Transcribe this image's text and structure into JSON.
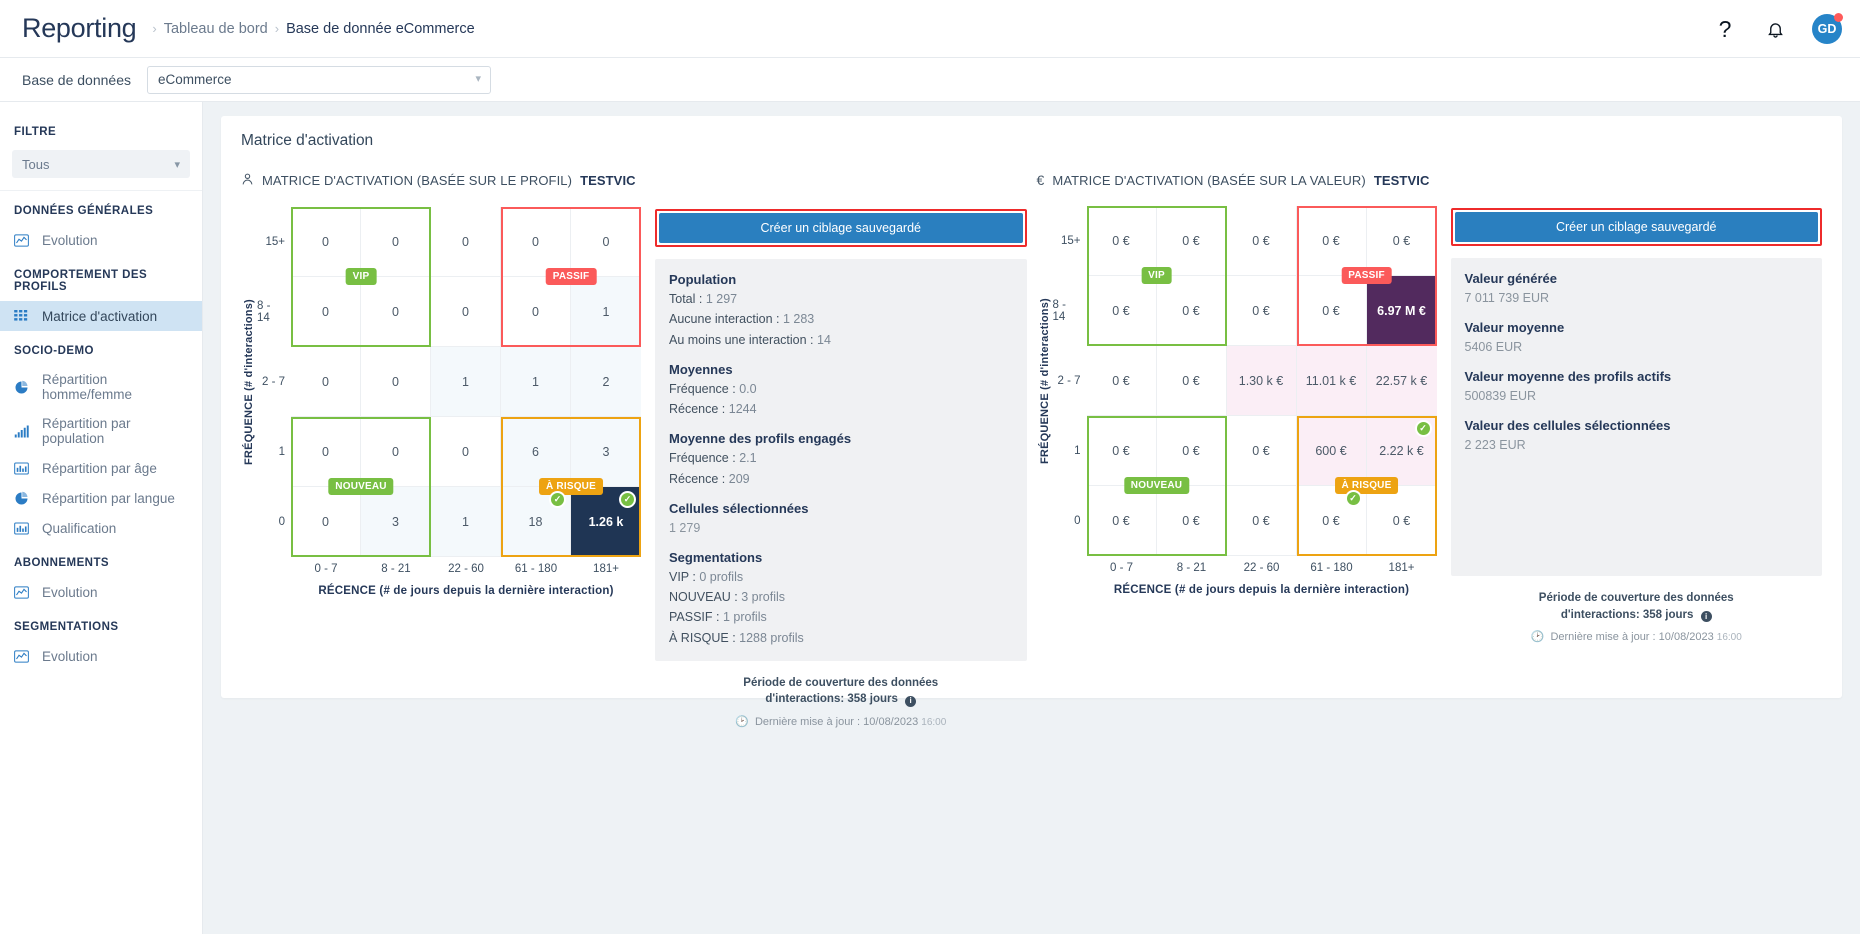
{
  "header": {
    "app_title": "Reporting",
    "breadcrumb": [
      "Tableau de bord",
      "Base de donnée eCommerce"
    ],
    "help_icon": "question-mark-icon",
    "bell_icon": "bell-icon",
    "avatar_initials": "GD"
  },
  "dbbar": {
    "label": "Base de données",
    "value": "eCommerce"
  },
  "sidebar": {
    "filter_heading": "FILTRE",
    "filter_value": "Tous",
    "sections": [
      {
        "heading": "DONNÉES GÉNÉRALES",
        "items": [
          {
            "label": "Evolution",
            "icon": "line-chart-icon",
            "active": false
          }
        ]
      },
      {
        "heading": "COMPORTEMENT DES PROFILS",
        "items": [
          {
            "label": "Matrice d'activation",
            "icon": "grid-icon",
            "active": true
          }
        ]
      },
      {
        "heading": "SOCIO-DEMO",
        "items": [
          {
            "label": "Répartition homme/femme",
            "icon": "pie-chart-icon",
            "active": false
          },
          {
            "label": "Répartition par population",
            "icon": "bar-chart-icon",
            "active": false
          },
          {
            "label": "Répartition par âge",
            "icon": "histogram-icon",
            "active": false
          },
          {
            "label": "Répartition par langue",
            "icon": "pie-chart-icon",
            "active": false
          },
          {
            "label": "Qualification",
            "icon": "histogram-icon",
            "active": false
          }
        ]
      },
      {
        "heading": "ABONNEMENTS",
        "items": [
          {
            "label": "Evolution",
            "icon": "line-chart-icon",
            "active": false
          }
        ]
      },
      {
        "heading": "SEGMENTATIONS",
        "items": [
          {
            "label": "Evolution",
            "icon": "line-chart-icon",
            "active": false
          }
        ]
      }
    ]
  },
  "main": {
    "card_title": "Matrice d'activation"
  },
  "chart_data": [
    {
      "type": "heatmap",
      "id": "profil",
      "title": "MATRICE D'ACTIVATION (BASÉE SUR LE PROFIL)",
      "title_suffix": "TESTVIC",
      "icon": "person-icon",
      "xlabel": "RÉCENCE (# de jours depuis la dernière interaction)",
      "ylabel": "FRÉQUENCE (# d'interactions)",
      "x_categories": [
        "0 - 7",
        "8 - 21",
        "22 - 60",
        "61 - 180",
        "181+"
      ],
      "y_categories": [
        "15+",
        "8 - 14",
        "2 - 7",
        "1",
        "0"
      ],
      "values": [
        [
          "0",
          "0",
          "0",
          "0",
          "0"
        ],
        [
          "0",
          "0",
          "0",
          "0",
          "1"
        ],
        [
          "0",
          "0",
          "1",
          "1",
          "2"
        ],
        [
          "0",
          "0",
          "0",
          "6",
          "3"
        ],
        [
          "0",
          "3",
          "1",
          "18",
          "1.26 k"
        ]
      ],
      "tints": [
        [
          "",
          "",
          "",
          "",
          ""
        ],
        [
          "",
          "",
          "",
          "",
          "tintblue"
        ],
        [
          "",
          "",
          "tintblue",
          "tintblue",
          "tintblue"
        ],
        [
          "",
          "",
          "",
          "tintblue",
          "tintblue"
        ],
        [
          "",
          "tintblue",
          "tintblue",
          "tintblue",
          "dark"
        ]
      ],
      "segments": [
        {
          "name": "VIP",
          "color": "green",
          "col": 0,
          "row": 0,
          "cols": 2,
          "rows": 2
        },
        {
          "name": "PASSIF",
          "color": "red",
          "col": 3,
          "row": 0,
          "cols": 2,
          "rows": 2
        },
        {
          "name": "NOUVEAU",
          "color": "green",
          "col": 0,
          "row": 3,
          "cols": 2,
          "rows": 2
        },
        {
          "name": "À RISQUE",
          "color": "orange",
          "col": 3,
          "row": 3,
          "cols": 2,
          "rows": 2
        }
      ],
      "checks": [
        {
          "col": 3,
          "row": 4
        },
        {
          "col": 4,
          "row": 4
        }
      ]
    },
    {
      "type": "heatmap",
      "id": "valeur",
      "title": "MATRICE D'ACTIVATION (BASÉE SUR LA VALEUR)",
      "title_suffix": "TESTVIC",
      "icon": "euro-icon",
      "xlabel": "RÉCENCE (# de jours depuis la dernière interaction)",
      "ylabel": "FRÉQUENCE (# d'interactions)",
      "x_categories": [
        "0 - 7",
        "8 - 21",
        "22 - 60",
        "61 - 180",
        "181+"
      ],
      "y_categories": [
        "15+",
        "8 - 14",
        "2 - 7",
        "1",
        "0"
      ],
      "values": [
        [
          "0 €",
          "0 €",
          "0 €",
          "0 €",
          "0 €"
        ],
        [
          "0 €",
          "0 €",
          "0 €",
          "0 €",
          "6.97 M €"
        ],
        [
          "0 €",
          "0 €",
          "1.30 k €",
          "11.01 k €",
          "22.57 k €"
        ],
        [
          "0 €",
          "0 €",
          "0 €",
          "600 €",
          "2.22 k €"
        ],
        [
          "0 €",
          "0 €",
          "0 €",
          "0 €",
          "0 €"
        ]
      ],
      "tints": [
        [
          "",
          "",
          "",
          "",
          ""
        ],
        [
          "",
          "",
          "",
          "",
          "purple"
        ],
        [
          "",
          "",
          "tintpink",
          "tintpink",
          "tintpink"
        ],
        [
          "",
          "",
          "",
          "tintpink",
          "tintpink"
        ],
        [
          "",
          "",
          "",
          "",
          ""
        ]
      ],
      "segments": [
        {
          "name": "VIP",
          "color": "green",
          "col": 0,
          "row": 0,
          "cols": 2,
          "rows": 2
        },
        {
          "name": "PASSIF",
          "color": "red",
          "col": 3,
          "row": 0,
          "cols": 2,
          "rows": 2
        },
        {
          "name": "NOUVEAU",
          "color": "green",
          "col": 0,
          "row": 3,
          "cols": 2,
          "rows": 2
        },
        {
          "name": "À RISQUE",
          "color": "orange",
          "col": 3,
          "row": 3,
          "cols": 2,
          "rows": 2
        }
      ],
      "checks": [
        {
          "col": 4,
          "row": 3
        },
        {
          "col": 3,
          "row": 4
        }
      ]
    }
  ],
  "left_panel": {
    "cta_label": "Créer un ciblage sauvegardé",
    "groups": [
      {
        "title": "Population",
        "lines": [
          {
            "k": "Total :",
            "v": "1 297"
          },
          {
            "k": "Aucune interaction :",
            "v": "1 283"
          },
          {
            "k": "Au moins une interaction :",
            "v": "14"
          }
        ]
      },
      {
        "title": "Moyennes",
        "lines": [
          {
            "k": "Fréquence :",
            "v": "0.0"
          },
          {
            "k": "Récence :",
            "v": "1244"
          }
        ]
      },
      {
        "title": "Moyenne des profils engagés",
        "lines": [
          {
            "k": "Fréquence :",
            "v": "2.1"
          },
          {
            "k": "Récence :",
            "v": "209"
          }
        ]
      },
      {
        "title": "Cellules sélectionnées",
        "plain": "1 279"
      },
      {
        "title": "Segmentations",
        "lines": [
          {
            "k": "VIP :",
            "v": "0 profils"
          },
          {
            "k": "NOUVEAU :",
            "v": "3 profils"
          },
          {
            "k": "PASSIF :",
            "v": "1 profils"
          },
          {
            "k": "À RISQUE :",
            "v": "1288 profils"
          }
        ]
      }
    ],
    "footer_line1": "Période de couverture des données",
    "footer_line2": "d'interactions: 358 jours",
    "footer_update_label": "Dernière mise à jour :",
    "footer_update_date": "10/08/2023",
    "footer_update_time": "16:00"
  },
  "right_panel": {
    "cta_label": "Créer un ciblage sauvegardé",
    "groups": [
      {
        "title": "Valeur générée",
        "plain": "7 011 739 EUR"
      },
      {
        "title": "Valeur moyenne",
        "plain": "5406 EUR"
      },
      {
        "title": "Valeur moyenne des profils actifs",
        "plain": "500839 EUR"
      },
      {
        "title": "Valeur des cellules sélectionnées",
        "plain": "2 223 EUR"
      }
    ],
    "footer_line1": "Période de couverture des données",
    "footer_line2": "d'interactions: 358 jours",
    "footer_update_label": "Dernière mise à jour :",
    "footer_update_date": "10/08/2023",
    "footer_update_time": "16:00"
  }
}
